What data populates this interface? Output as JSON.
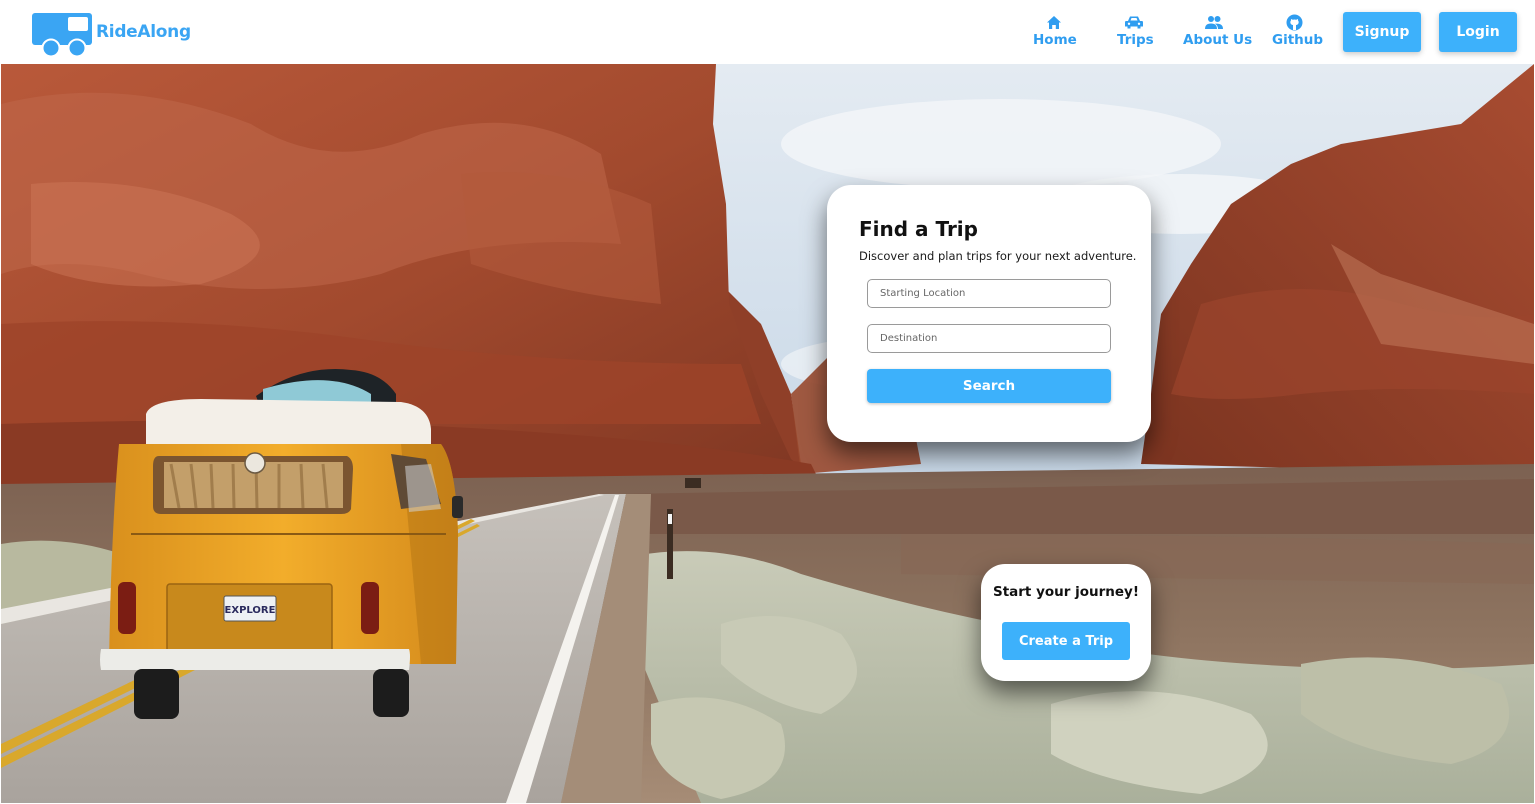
{
  "brand": {
    "name": "RideAlong",
    "logo_icon": "bus-logo-icon"
  },
  "nav": {
    "links": [
      {
        "label": "Home",
        "icon": "home-icon"
      },
      {
        "label": "Trips",
        "icon": "car-icon"
      },
      {
        "label": "About Us",
        "icon": "people-icon"
      },
      {
        "label": "Github",
        "icon": "github-icon"
      }
    ],
    "signup_label": "Signup",
    "login_label": "Login"
  },
  "hero": {
    "image": "desert road with yellow van, red rock canyon",
    "plate_text": "EXPLORE"
  },
  "find_trip": {
    "title": "Find a Trip",
    "subtitle": "Discover and plan trips for your next adventure.",
    "start_placeholder": "Starting Location",
    "destination_placeholder": "Destination",
    "search_label": "Search"
  },
  "journey": {
    "title": "Start your journey!",
    "create_label": "Create a Trip"
  },
  "colors": {
    "accent": "#3db1fb",
    "link": "#2f9df0",
    "brand": "#3aa5f3"
  }
}
